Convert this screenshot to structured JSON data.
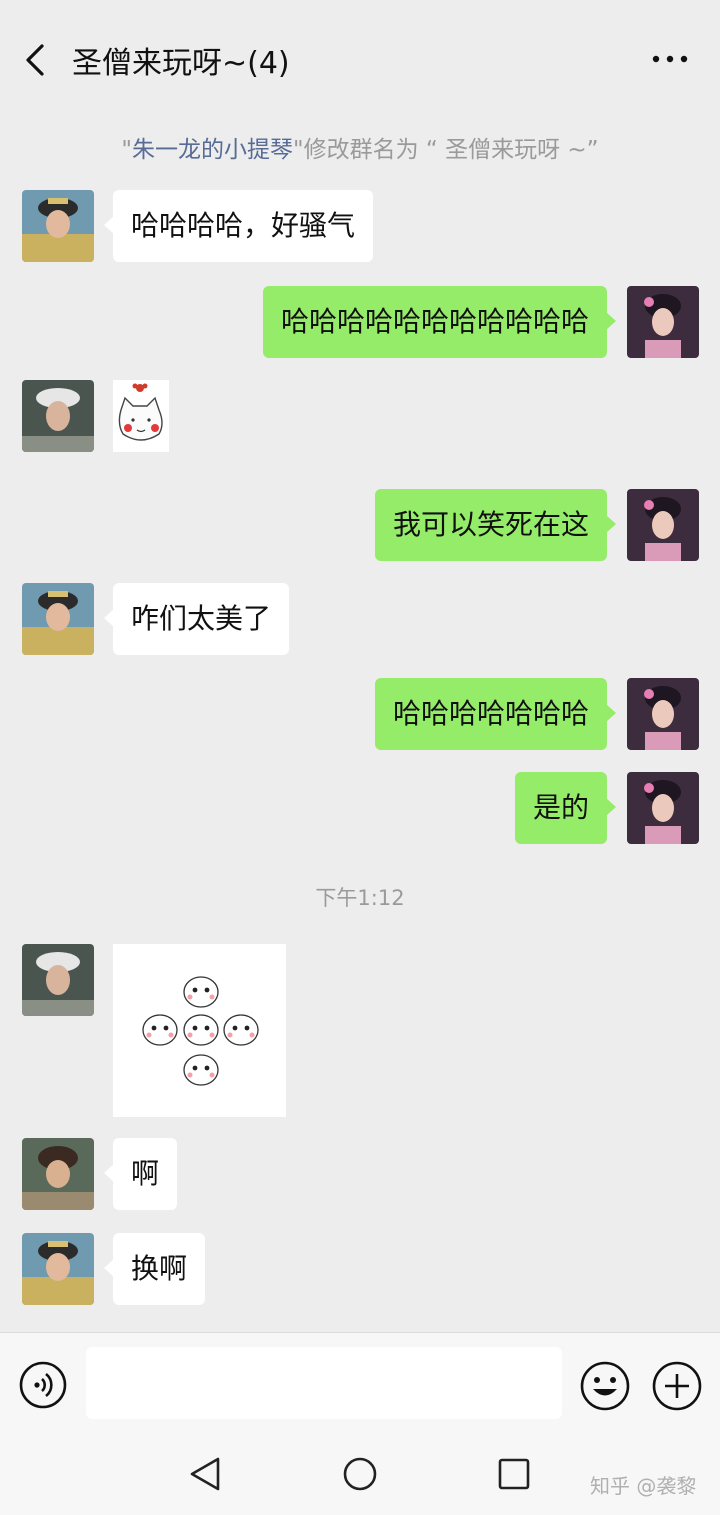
{
  "header": {
    "title": "圣僧来玩呀~(4)"
  },
  "notice": {
    "quote_open": "\"",
    "name": "朱一龙的小提琴",
    "text": "\"修改群名为 “ 圣僧来玩呀 ~”"
  },
  "messages": [
    {
      "text": "哈哈哈哈，好骚气"
    },
    {
      "text": "哈哈哈哈哈哈哈哈哈哈哈"
    },
    {
      "text": "我可以笑死在这"
    },
    {
      "text": "咋们太美了"
    },
    {
      "text": "哈哈哈哈哈哈哈"
    },
    {
      "text": "是的"
    },
    {
      "text": "啊"
    },
    {
      "text": "换啊"
    }
  ],
  "timestamp": "下午1:12",
  "input": {
    "value": ""
  },
  "watermark": "知乎 @袭黎",
  "colors": {
    "background": "#ededed",
    "outgoing_bubble": "#95ec69",
    "incoming_bubble": "#ffffff",
    "link": "#576b95"
  },
  "icons": [
    "back-arrow-icon",
    "more-icon",
    "voice-icon",
    "emoji-icon",
    "plus-icon",
    "nav-back-icon",
    "nav-home-icon",
    "nav-recent-icon"
  ]
}
